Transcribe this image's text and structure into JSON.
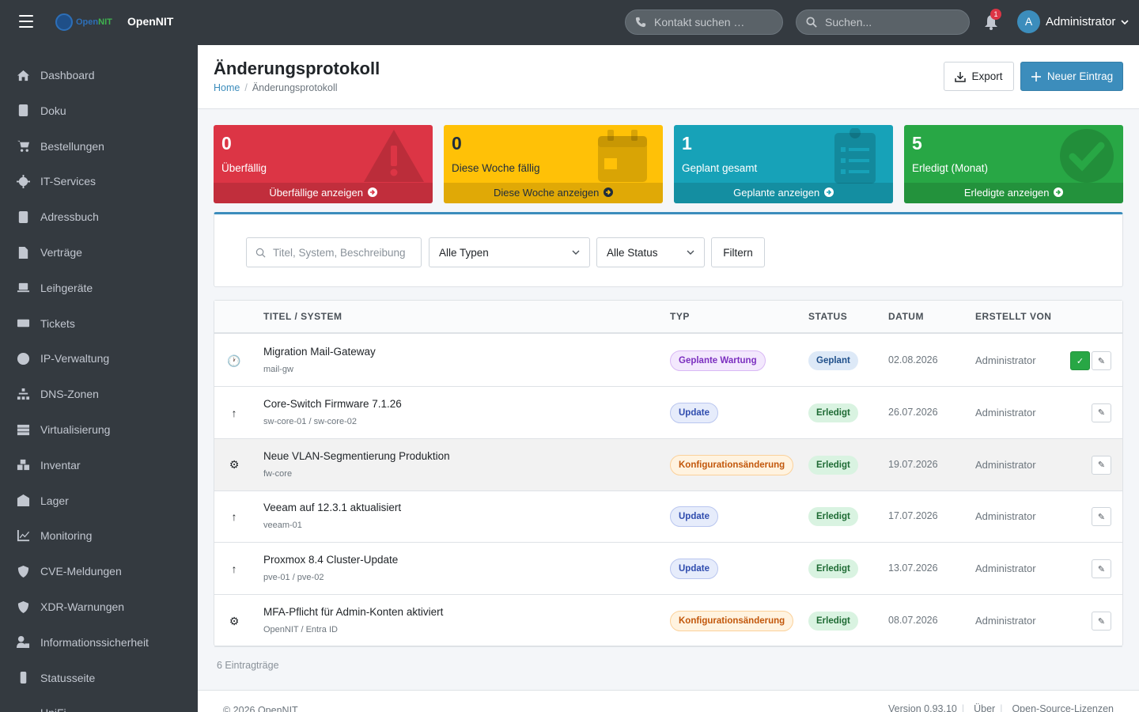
{
  "app": {
    "brand_name": "OpenNIT",
    "logo_text_a": "Open",
    "logo_text_b": "NIT"
  },
  "topbar": {
    "contact_placeholder": "Kontakt suchen …",
    "search_placeholder": "Suchen...",
    "notification_count": "1",
    "user_initial": "A",
    "user_name": "Administrator"
  },
  "sidebar": {
    "items": [
      {
        "label": "Dashboard",
        "icon": "home-icon"
      },
      {
        "label": "Doku",
        "icon": "book-icon"
      },
      {
        "label": "Bestellungen",
        "icon": "cart-icon"
      },
      {
        "label": "IT-Services",
        "icon": "gear-icon"
      },
      {
        "label": "Adressbuch",
        "icon": "address-book-icon"
      },
      {
        "label": "Verträge",
        "icon": "contract-icon"
      },
      {
        "label": "Leihgeräte",
        "icon": "laptop-icon"
      },
      {
        "label": "Tickets",
        "icon": "ticket-icon"
      },
      {
        "label": "IP-Verwaltung",
        "icon": "globe-icon"
      },
      {
        "label": "DNS-Zonen",
        "icon": "sitemap-icon"
      },
      {
        "label": "Virtualisierung",
        "icon": "server-icon"
      },
      {
        "label": "Inventar",
        "icon": "boxes-icon"
      },
      {
        "label": "Lager",
        "icon": "warehouse-icon"
      },
      {
        "label": "Monitoring",
        "icon": "chart-line-icon"
      },
      {
        "label": "CVE-Meldungen",
        "icon": "shield-icon"
      },
      {
        "label": "XDR-Warnungen",
        "icon": "shield-virus-icon"
      },
      {
        "label": "Informationssicherheit",
        "icon": "user-lock-icon"
      },
      {
        "label": "Statusseite",
        "icon": "traffic-light-icon"
      },
      {
        "label": "UniFi",
        "icon": "wifi-icon"
      }
    ]
  },
  "header": {
    "title": "Änderungsprotokoll",
    "breadcrumb_home": "Home",
    "breadcrumb_current": "Änderungsprotokoll",
    "export_label": "Export",
    "new_label": "Neuer Eintrag"
  },
  "stats": [
    {
      "value": "0",
      "label": "Überfällig",
      "link": "Überfällige anzeigen",
      "icon": "warning-icon"
    },
    {
      "value": "0",
      "label": "Diese Woche fällig",
      "link": "Diese Woche anzeigen",
      "icon": "calendar-icon"
    },
    {
      "value": "1",
      "label": "Geplant gesamt",
      "link": "Geplante anzeigen",
      "icon": "clipboard-list-icon"
    },
    {
      "value": "5",
      "label": "Erledigt (Monat)",
      "link": "Erledigte anzeigen",
      "icon": "check-circle-icon"
    }
  ],
  "filter": {
    "search_placeholder": "Titel, System, Beschreibung",
    "type_selected": "Alle Typen",
    "status_selected": "Alle Status",
    "filter_label": "Filtern"
  },
  "table": {
    "headers": {
      "title": "TITEL / SYSTEM",
      "type": "TYP",
      "status": "STATUS",
      "date": "DATUM",
      "created_by": "ERSTELLT VON"
    },
    "rows": [
      {
        "icon": "🕐",
        "icon_name": "clock-icon",
        "title": "Migration Mail-Gateway",
        "system": "mail-gw",
        "type": "Geplante Wartung",
        "status": "Geplant",
        "date": "02.08.2026",
        "user": "Administrator"
      },
      {
        "icon": "↑",
        "icon_name": "arrow-up-icon",
        "title": "Core-Switch Firmware 7.1.26",
        "system": "sw-core-01 / sw-core-02",
        "type": "Update",
        "status": "Erledigt",
        "date": "26.07.2026",
        "user": "Administrator"
      },
      {
        "icon": "⚙",
        "icon_name": "gear-icon",
        "title": "Neue VLAN-Segmentierung Produktion",
        "system": "fw-core",
        "type": "Konfigurationsänderung",
        "status": "Erledigt",
        "date": "19.07.2026",
        "user": "Administrator"
      },
      {
        "icon": "↑",
        "icon_name": "arrow-up-icon",
        "title": "Veeam auf 12.3.1 aktualisiert",
        "system": "veeam-01",
        "type": "Update",
        "status": "Erledigt",
        "date": "17.07.2026",
        "user": "Administrator"
      },
      {
        "icon": "↑",
        "icon_name": "arrow-up-icon",
        "title": "Proxmox 8.4 Cluster-Update",
        "system": "pve-01 / pve-02",
        "type": "Update",
        "status": "Erledigt",
        "date": "13.07.2026",
        "user": "Administrator"
      },
      {
        "icon": "⚙",
        "icon_name": "gear-icon",
        "title": "MFA-Pflicht für Admin-Konten aktiviert",
        "system": "OpenNIT / Entra ID",
        "type": "Konfigurationsänderung",
        "status": "Erledigt",
        "date": "08.07.2026",
        "user": "Administrator"
      }
    ],
    "check_symbol": "✓",
    "edit_symbol": "✎"
  },
  "count_text": "6 Eintragträge",
  "footer": {
    "copyright": "© 2026 OpenNIT",
    "version": "Version 0.93.10",
    "about": "Über",
    "licenses": "Open-Source-Lizenzen"
  },
  "colors": {
    "red": "#dc3545",
    "yellow": "#ffc107",
    "cyan": "#17a2b8",
    "green": "#28a745",
    "primary": "#3c8dbc",
    "sidebar": "#343a40"
  }
}
